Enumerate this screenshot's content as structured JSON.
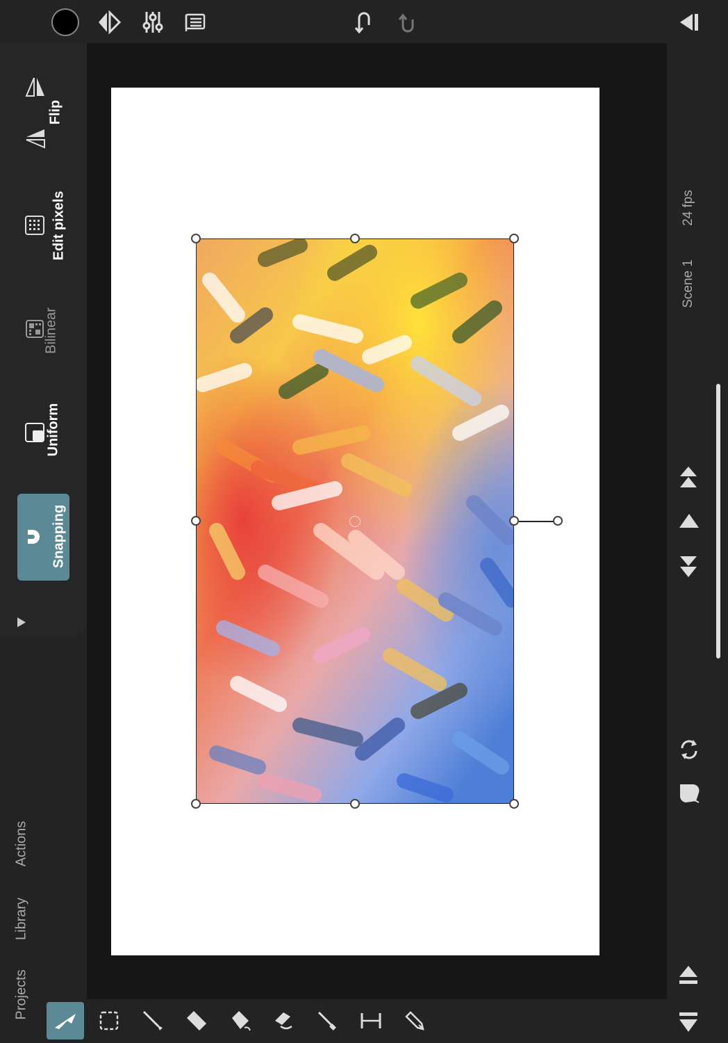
{
  "app": {
    "accent_color": "#5b8a96",
    "background_color": "#232323",
    "canvas_background": "#161616",
    "paper_color": "#ffffff"
  },
  "top_toolbar": {
    "items": [
      {
        "icon": "color-swatch-icon",
        "color": "#000000"
      },
      {
        "icon": "brush-style-icon"
      },
      {
        "icon": "adjustments-icon"
      },
      {
        "icon": "layers-icon"
      },
      {
        "icon": "undo-icon"
      },
      {
        "icon": "redo-icon"
      },
      {
        "icon": "collapse-panel-icon"
      }
    ]
  },
  "transform_panel": {
    "flip_label": "Flip",
    "edit_pixels_label": "Edit pixels",
    "bilinear_label": "Bilinear",
    "uniform_label": "Uniform",
    "snapping_label": "Snapping"
  },
  "left_nav": {
    "actions_label": "Actions",
    "library_label": "Library",
    "projects_label": "Projects"
  },
  "right_panel": {
    "fps_label": "24 fps",
    "scene_label": "Scene 1"
  },
  "bottom_toolbar": {
    "tools": [
      {
        "icon": "transform-tool-icon",
        "active": true
      },
      {
        "icon": "selection-tool-icon"
      },
      {
        "icon": "brush-tool-icon"
      },
      {
        "icon": "eraser-tool-icon"
      },
      {
        "icon": "fill-tool-icon"
      },
      {
        "icon": "smudge-tool-icon"
      },
      {
        "icon": "eyedropper-tool-icon"
      },
      {
        "icon": "ruler-tool-icon"
      },
      {
        "icon": "pen-tool-icon"
      }
    ]
  }
}
